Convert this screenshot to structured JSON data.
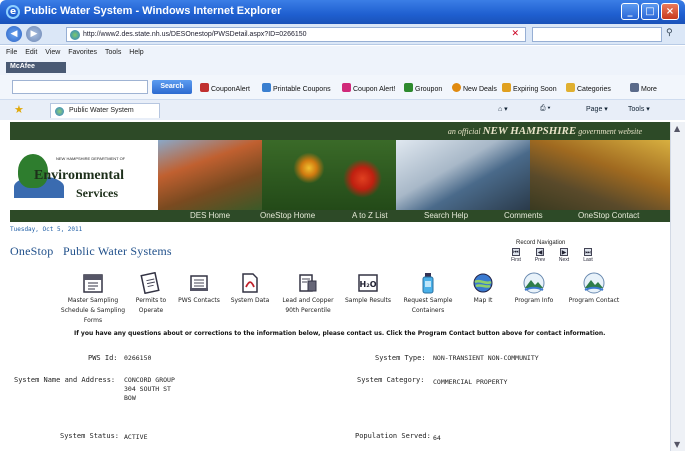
{
  "browser": {
    "title": "Public Water System - Windows Internet Explorer",
    "address": "http://www2.des.state.nh.us/DESOnestop/PWSDetail.aspx?ID=0266150",
    "menu": [
      "File",
      "Edit",
      "View",
      "Favorites",
      "Tools",
      "Help"
    ],
    "mcafee_label": "McAfee",
    "search_button": "Search",
    "toolbar_items": [
      {
        "label": "CouponAlert",
        "color": "#c03030"
      },
      {
        "label": "Printable Coupons",
        "color": "#3a7fd0"
      },
      {
        "label": "Coupon Alert!",
        "color": "#d02a7a"
      },
      {
        "label": "Groupon",
        "color": "#2e8a2e"
      },
      {
        "label": "New Deals",
        "color": "#e08a10"
      },
      {
        "label": "Expiring Soon",
        "color": "#e0a020"
      },
      {
        "label": "Categories",
        "color": "#e0b030"
      },
      {
        "label": "More",
        "color": "#5a6a8a"
      }
    ],
    "tab_title": "Public Water System",
    "cmd_page": "Page",
    "cmd_tools": "Tools"
  },
  "site": {
    "official_prefix": "an official",
    "state_name": "NEW HAMPSHIRE",
    "official_suffix": "government website",
    "logo_small": "NEW HAMPSHIRE DEPARTMENT OF",
    "logo_env": "Environmental",
    "logo_services": "Services",
    "nav": [
      "DES Home",
      "OneStop Home",
      "A to Z List",
      "Search Help",
      "Comments",
      "OneStop Contact"
    ]
  },
  "page": {
    "date": "Tuesday, Oct 5, 2011",
    "heading": "OneStop   Public Water Systems",
    "record_nav_label": "Record Navigation",
    "record_nav": [
      "First",
      "Prev",
      "Next",
      "Last"
    ],
    "icons": [
      {
        "label1": "Master Sampling",
        "label2": "Schedule & Sampling",
        "label3": "Forms",
        "icon": "calendar-icon"
      },
      {
        "label1": "Permits to",
        "label2": "Operate",
        "label3": "",
        "icon": "permits-icon"
      },
      {
        "label1": "PWS Contacts",
        "label2": "",
        "label3": "",
        "icon": "contacts-icon"
      },
      {
        "label1": "System Data",
        "label2": "",
        "label3": "",
        "icon": "pdf-icon"
      },
      {
        "label1": "Lead and Copper",
        "label2": "90th Percentile",
        "label3": "",
        "icon": "lead-copper-icon"
      },
      {
        "label1": "Sample Results",
        "label2": "",
        "label3": "",
        "icon": "h2o-icon"
      },
      {
        "label1": "Request Sample",
        "label2": "Containers",
        "label3": "",
        "icon": "bottle-icon"
      },
      {
        "label1": "Map It",
        "label2": "",
        "label3": "",
        "icon": "globe-icon"
      },
      {
        "label1": "Program Info",
        "label2": "",
        "label3": "",
        "icon": "mountain-info-icon"
      },
      {
        "label1": "Program Contact",
        "label2": "",
        "label3": "",
        "icon": "mountain-contact-icon"
      }
    ],
    "notice": "If you have any questions about or corrections to the information below, please contact us. Click the Program Contact button above for contact information.",
    "fields": {
      "pws_id_label": "PWS Id:",
      "pws_id": "0266150",
      "system_type_label": "System Type:",
      "system_type": "NON-TRANSIENT NON-COMMUNITY",
      "name_address_label": "System Name and Address:",
      "name_line1": "CONCORD GROUP",
      "name_line2": "304 SOUTH ST",
      "name_line3": "BOW",
      "category_label": "System Category:",
      "category": "COMMERCIAL PROPERTY",
      "status_label": "System Status:",
      "status": "ACTIVE",
      "population_label": "Population Served:",
      "population": "64"
    }
  }
}
